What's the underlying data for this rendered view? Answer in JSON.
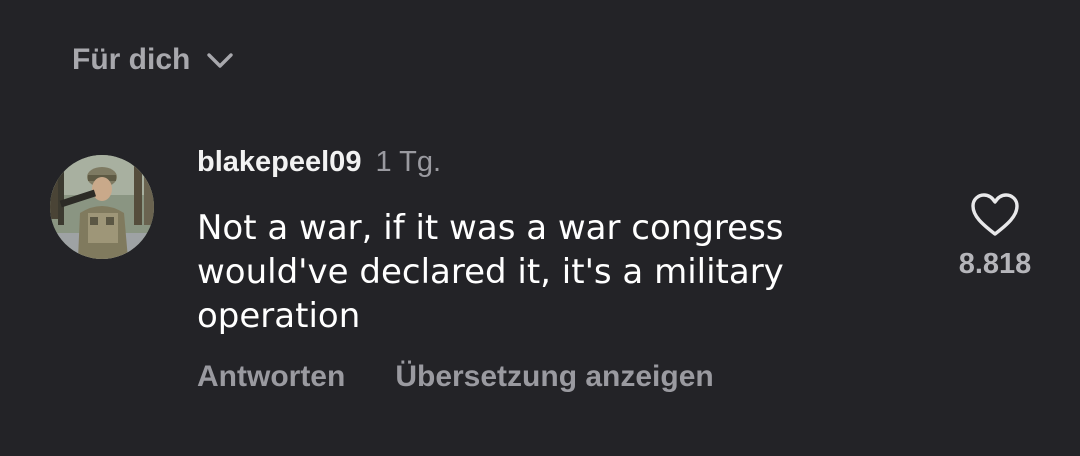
{
  "sort": {
    "label": "Für dich",
    "icon": "chevron-down-icon"
  },
  "comment": {
    "username": "blakepeel09",
    "time": "1 Tg.",
    "text": "Not a war, if it was a war congress\nwould've declared it, it's a military\noperation",
    "actions": {
      "reply": "Antworten",
      "translate": "Übersetzung anzeigen"
    },
    "likes": {
      "count": "8.818",
      "icon": "heart-icon"
    }
  },
  "colors": {
    "background": "#232327",
    "primary_text": "#ffffff",
    "secondary_text": "#9a9aa0"
  }
}
